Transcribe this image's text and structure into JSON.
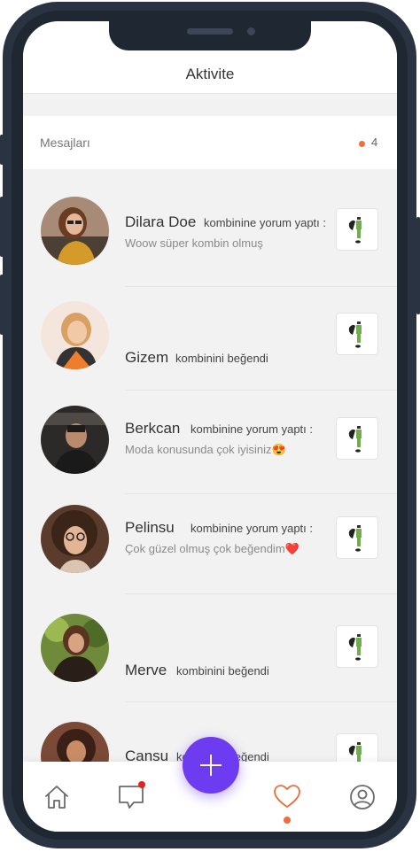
{
  "header": {
    "title": "Aktivite"
  },
  "messages": {
    "label": "Mesajları",
    "count": "4",
    "dot_color": "#f26b3a"
  },
  "activities": [
    {
      "name": "Dilara Doe",
      "action": "kombinine yorum yaptı :",
      "comment": "Woow süper kombin olmuş"
    },
    {
      "name": "Gizem",
      "action": "kombinini beğendi",
      "comment": ""
    },
    {
      "name": "Berkcan",
      "action": "kombinine yorum yaptı :",
      "comment": "Moda konusunda çok iyisiniz😍"
    },
    {
      "name": "Pelinsu",
      "action": "kombinine yorum yaptı :",
      "comment": "Çok güzel olmuş çok beğendim❤️"
    },
    {
      "name": "Merve",
      "action": "kombinini beğendi",
      "comment": ""
    },
    {
      "name": "Cansu",
      "action": "kombinini beğendi",
      "comment": ""
    }
  ],
  "tabs": [
    {
      "icon": "home-icon"
    },
    {
      "icon": "chat-icon"
    },
    {
      "icon": "add-icon"
    },
    {
      "icon": "heart-icon"
    },
    {
      "icon": "profile-icon"
    }
  ],
  "colors": {
    "accent": "#6e3cf0",
    "active": "#f26b3a",
    "notification": "#e02424"
  }
}
